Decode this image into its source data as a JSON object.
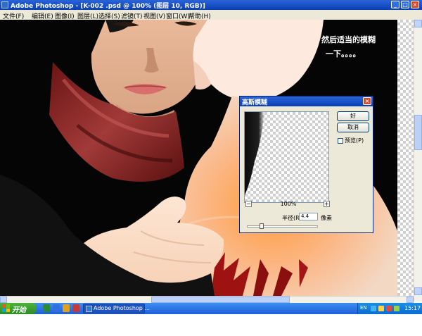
{
  "window": {
    "title": "Adobe Photoshop - [K-002 .psd @ 100% (图层 10, RGB)]",
    "minimize_glyph": "_",
    "maximize_glyph": "□",
    "close_glyph": "×"
  },
  "menu": {
    "items": [
      "文件(F)",
      "编辑(E)",
      "图像(I)",
      "图层(L)",
      "选择(S)",
      "滤镜(T)",
      "视图(V)",
      "窗口(W)",
      "帮助(H)"
    ]
  },
  "canvas": {
    "annotation_line1": "然后适当的模糊",
    "annotation_line2": "一下。。。。"
  },
  "dialog": {
    "title": "高斯模糊",
    "close_glyph": "×",
    "ok_label": "好",
    "cancel_label": "取消",
    "preview_label": "预览(P)",
    "preview_checked": false,
    "zoom_out_glyph": "−",
    "zoom_in_glyph": "+",
    "zoom_level": "100%",
    "radius_label": "半径(R):",
    "radius_value": "4.4",
    "radius_unit": "像素"
  },
  "taskbar": {
    "start_label": "开始",
    "task_label": "Adobe Photoshop ...",
    "lang": "EN",
    "time": "15:17"
  },
  "icons": {
    "photoshop": "photoshop-icon",
    "windows_logo": "windows-logo-icon"
  }
}
